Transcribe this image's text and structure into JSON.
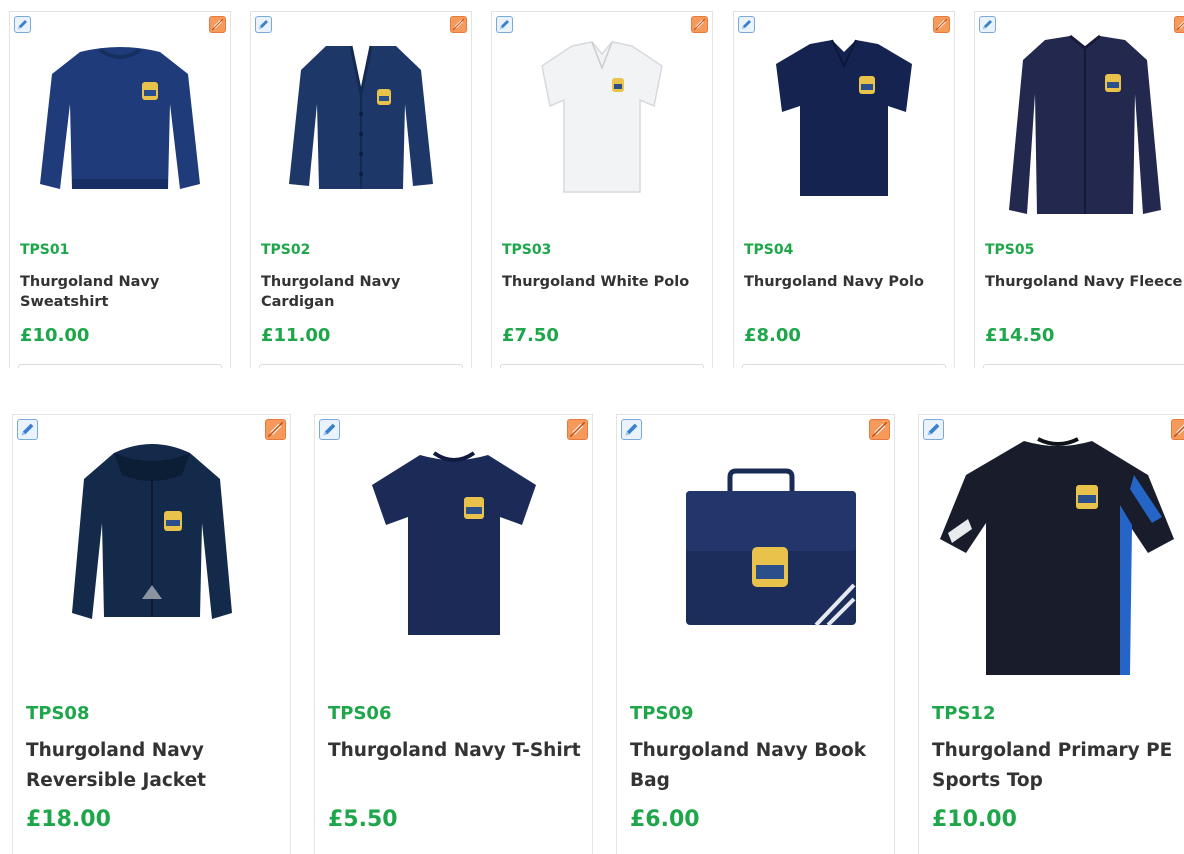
{
  "colors": {
    "accent_green": "#1ea64a",
    "product_name": "#333333",
    "edit_icon_border": "#7aa9dc",
    "delete_icon_fill": "#f59a5b",
    "card_border": "#e3e3e3"
  },
  "icons": {
    "edit": "pencil-edit-icon",
    "delete": "pencil-delete-icon"
  },
  "products": [
    {
      "sku": "TPS01",
      "name": "Thurgoland Navy Sweatshirt",
      "price": "£10.00",
      "image": "navy-sweatshirt"
    },
    {
      "sku": "TPS02",
      "name": "Thurgoland Navy Cardigan",
      "price": "£11.00",
      "image": "navy-cardigan"
    },
    {
      "sku": "TPS03",
      "name": "Thurgoland White Polo",
      "price": "£7.50",
      "image": "white-polo"
    },
    {
      "sku": "TPS04",
      "name": "Thurgoland Navy Polo",
      "price": "£8.00",
      "image": "navy-polo"
    },
    {
      "sku": "TPS05",
      "name": "Thurgoland Navy Fleece",
      "price": "£14.50",
      "image": "navy-fleece"
    },
    {
      "sku": "TPS08",
      "name": "Thurgoland Navy Reversible Jacket",
      "price": "£18.00",
      "image": "navy-jacket"
    },
    {
      "sku": "TPS06",
      "name": "Thurgoland Navy T-Shirt",
      "price": "£5.50",
      "image": "navy-tshirt"
    },
    {
      "sku": "TPS09",
      "name": "Thurgoland Navy Book Bag",
      "price": "£6.00",
      "image": "navy-book-bag"
    },
    {
      "sku": "TPS12",
      "name": "Thurgoland Primary PE Sports Top",
      "price": "£10.00",
      "image": "pe-sports-top"
    }
  ]
}
